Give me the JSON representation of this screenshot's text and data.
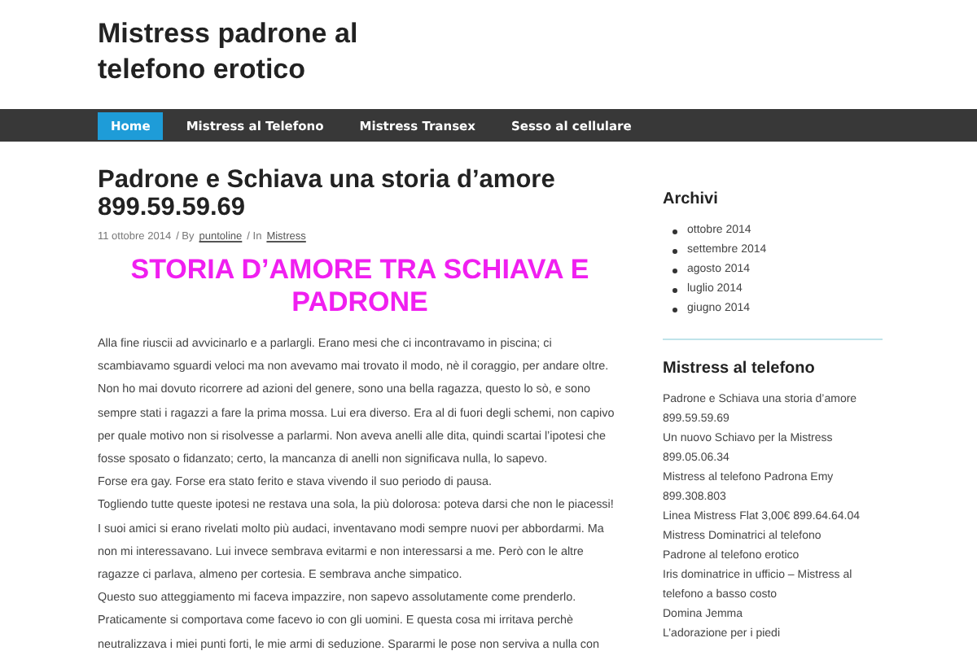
{
  "site": {
    "title": "Mistress padrone al telefono erotico"
  },
  "nav": [
    {
      "label": "Home",
      "selected": true
    },
    {
      "label": "Mistress al Telefono",
      "selected": false
    },
    {
      "label": "Mistress Transex",
      "selected": false
    },
    {
      "label": "Sesso al cellulare",
      "selected": false
    }
  ],
  "post": {
    "title": "Padrone e Schiava una storia d’amore 899.59.59.69",
    "date": "11 ottobre 2014",
    "by": "/ By",
    "author": "puntoline",
    "in": "/ In",
    "category": "Mistress",
    "heading": "STORIA D’AMORE TRA SCHIAVA E PADRONE",
    "paragraphs": [
      "Alla fine riuscii ad avvicinarlo e a parlargli. Erano mesi che ci incontravamo in piscina; ci scambiavamo sguardi veloci ma non avevamo mai trovato il modo, nè il coraggio, per andare oltre. Non ho mai dovuto ricorrere ad azioni del genere, sono una bella ragazza, questo lo sò, e sono sempre stati i ragazzi a fare la prima mossa. Lui era diverso. Era al di fuori degli schemi, non capivo",
      "per quale motivo non si risolvesse a parlarmi. Non aveva anelli alle dita, quindi scartai l’ipotesi che fosse sposato o fidanzato; certo, la mancanza di anelli non significava nulla, lo sapevo.",
      "Forse era gay. Forse era stato ferito e stava vivendo il suo periodo di pausa.",
      "Togliendo tutte queste ipotesi ne restava una sola, la più dolorosa: poteva darsi che non le piacessi!",
      "I suoi amici si erano rivelati molto più audaci, inventavano modi sempre nuovi per abbordarmi. Ma non mi interessavano. Lui invece sembrava evitarmi e non interessarsi a me. Però con le altre ragazze ci parlava, almeno per cortesia. E sembrava anche simpatico.",
      "Questo suo atteggiamento mi faceva impazzire, non sapevo assolutamente come prenderlo. Praticamente si comportava come facevo io con gli uomini. E questa cosa mi irritava perchè neutralizzava i miei punti forti, le mie armi di seduzione. Spararmi le pose non serviva a nulla con"
    ]
  },
  "sidebar": {
    "archive": {
      "title": "Archivi",
      "items": [
        "ottobre 2014",
        "settembre 2014",
        "agosto 2014",
        "luglio 2014",
        "giugno 2014"
      ]
    },
    "recent": {
      "title": "Mistress al telefono",
      "items": [
        "Padrone e Schiava una storia d’amore 899.59.59.69",
        "Un nuovo Schiavo per la Mistress 899.05.06.34",
        "Mistress al telefono Padrona Emy 899.308.803",
        "Linea Mistress Flat 3,00€ 899.64.64.04",
        "Mistress Dominatrici al telefono",
        "Padrone al telefono erotico",
        "Iris dominatrice in ufficio – Mistress al telefono a basso costo",
        "Domina Jemma",
        "L’adorazione per i piedi"
      ]
    }
  }
}
